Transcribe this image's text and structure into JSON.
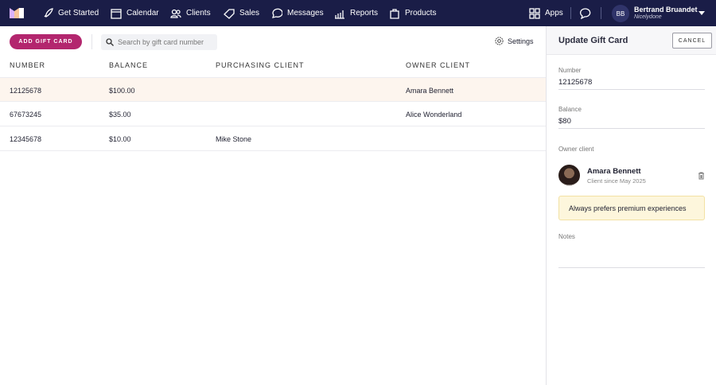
{
  "nav": {
    "items": [
      {
        "label": "Get Started",
        "icon": "rocket-icon"
      },
      {
        "label": "Calendar",
        "icon": "calendar-icon"
      },
      {
        "label": "Clients",
        "icon": "clients-icon"
      },
      {
        "label": "Sales",
        "icon": "tag-icon"
      },
      {
        "label": "Messages",
        "icon": "message-icon"
      },
      {
        "label": "Reports",
        "icon": "chart-icon"
      },
      {
        "label": "Products",
        "icon": "bag-icon"
      }
    ],
    "apps": "Apps",
    "user": {
      "initials": "BB",
      "name": "Bertrand Bruandet",
      "org": "Nicelydone"
    }
  },
  "toolbar": {
    "add_label": "ADD GIFT CARD",
    "search_placeholder": "Search by gift card number",
    "settings": "Settings"
  },
  "table": {
    "headers": [
      "NUMBER",
      "BALANCE",
      "PURCHASING CLIENT",
      "OWNER CLIENT"
    ],
    "rows": [
      [
        "12125678",
        "$100.00",
        "",
        "Amara Bennett"
      ],
      [
        "67673245",
        "$35.00",
        "",
        "Alice Wonderland"
      ],
      [
        "12345678",
        "$10.00",
        "Mike Stone",
        ""
      ]
    ]
  },
  "panel": {
    "title": "Update Gift Card",
    "cancel": "CANCEL",
    "number_label": "Number",
    "number": "12125678",
    "balance_label": "Balance",
    "balance": "$80",
    "owner_label": "Owner client",
    "owner_name": "Amara Bennett",
    "owner_since": "Client since May 2025",
    "note": "Always prefers premium experiences",
    "notes_label": "Notes"
  },
  "colors": {
    "nav": "#1a1d47",
    "accent": "#b3266e",
    "selected_row": "#fdf5ee"
  }
}
